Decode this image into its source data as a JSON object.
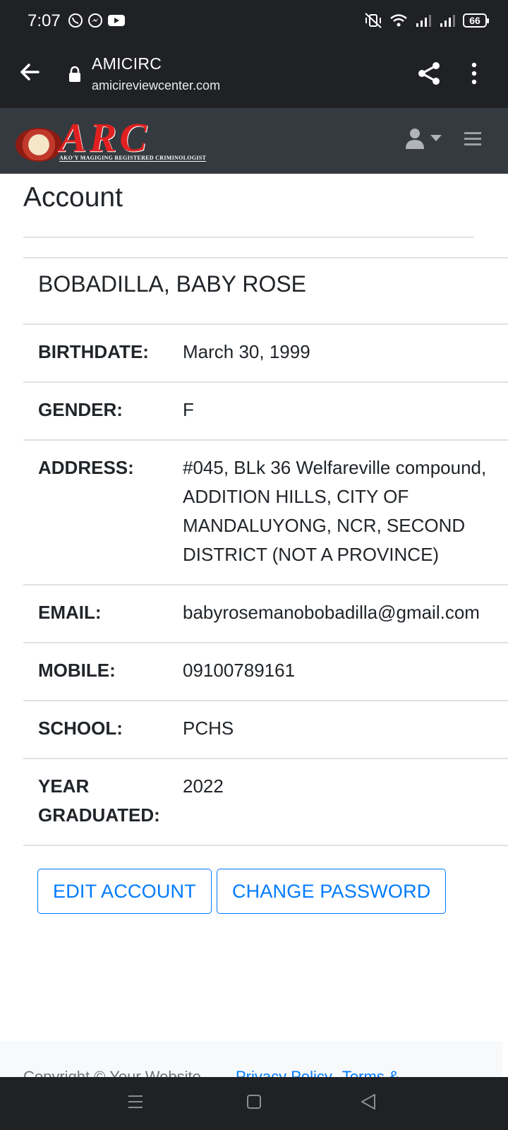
{
  "status_bar": {
    "time": "7:07",
    "battery": "66",
    "notification_icons": [
      "viber-icon",
      "messenger-icon",
      "youtube-icon"
    ],
    "system_icons": [
      "mute-vibrate-icon",
      "wifi-icon",
      "signal-icon",
      "signal-icon",
      "battery-icon"
    ]
  },
  "browser": {
    "site_title": "AMICIRC",
    "url": "amicireviewcenter.com"
  },
  "navbar": {
    "logo_text": "ARC",
    "logo_tagline": "AKO'Y MAGIGING REGISTERED CRIMINOLOGIST"
  },
  "page": {
    "title": "Account"
  },
  "profile": {
    "name": "BOBADILLA, BABY ROSE",
    "fields": [
      {
        "label": "BIRTHDATE:",
        "value": "March 30, 1999"
      },
      {
        "label": "GENDER:",
        "value": "F"
      },
      {
        "label": "ADDRESS:",
        "value": "#045, BLk 36 Welfareville compound, ADDITION HILLS, CITY OF MANDALUYONG, NCR, SECOND DISTRICT (NOT A PROVINCE)"
      },
      {
        "label": "EMAIL:",
        "value": "babyrosemanobobadilla@gmail.com"
      },
      {
        "label": "MOBILE:",
        "value": "09100789161"
      },
      {
        "label": "SCHOOL:",
        "value": "PCHS"
      },
      {
        "label": "YEAR GRADUATED:",
        "value": "2022"
      }
    ]
  },
  "actions": {
    "edit_label": "EDIT ACCOUNT",
    "change_password_label": "CHANGE PASSWORD"
  },
  "footer": {
    "copyright": "Copyright © Your Website",
    "privacy": "Privacy Policy",
    "terms": "Terms &"
  },
  "colors": {
    "primary": "#007bff",
    "navbar_bg": "#343a40",
    "browser_bg": "#202124",
    "logo_red": "#e02020"
  }
}
